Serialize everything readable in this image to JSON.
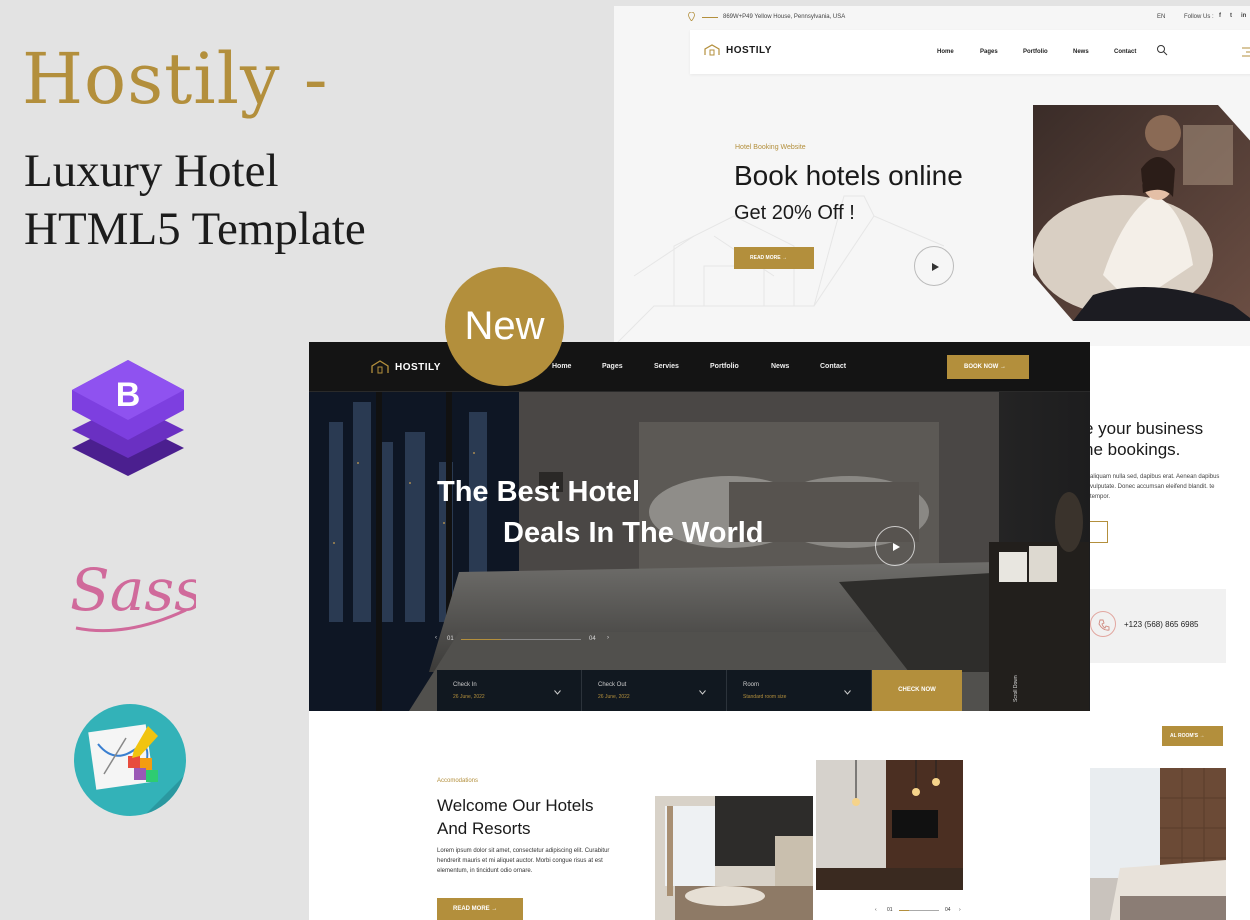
{
  "promo": {
    "title": "Hostily -",
    "subtitle_line1": "Luxury Hotel",
    "subtitle_line2": "HTML5 Template"
  },
  "badge": {
    "label": "New"
  },
  "colors": {
    "accent": "#b38f3c",
    "dark": "#141414",
    "light_bg": "#f6f6f6"
  },
  "icons": [
    "bootstrap-logo",
    "sass-logo",
    "design-palette-logo"
  ],
  "light_site": {
    "topbar": {
      "address": "869W+P49 Yellow House, Pennsylvania, USA",
      "language": "EN",
      "follow_label": "Follow Us :",
      "social": [
        "f",
        "t",
        "in"
      ]
    },
    "brand": "HOSTILY",
    "nav": [
      "Home",
      "Pages",
      "Portfolio",
      "News",
      "Contact"
    ],
    "hero": {
      "tag": "Hotel Booking Website",
      "heading": "Book hotels online",
      "subheading": "Get 20% Off !",
      "button": "READ MORE"
    },
    "about": {
      "heading_line1": "e your business",
      "heading_line2": "ne bookings.",
      "paragraph": "aliquam nulla sed, dapibus erat. Aenean dapibus vulputate. Donec accumsan eleifend blandit. te tempor."
    },
    "phone": "+123 (568) 865 6985",
    "rooms_button": "AL ROOM'S"
  },
  "dark_site": {
    "brand": "HOSTILY",
    "nav": [
      "Home",
      "Pages",
      "Servies",
      "Portfolio",
      "News",
      "Contact"
    ],
    "book_button": "BOOK NOW",
    "hero": {
      "title_line1": "The Best Hotel",
      "title_line2": "Deals In The World"
    },
    "slider": {
      "current": "01",
      "total": "04"
    },
    "booking": {
      "fields": [
        {
          "label": "Check In",
          "value": "26 June, 2022"
        },
        {
          "label": "Check Out",
          "value": "26 June, 2022"
        },
        {
          "label": "Room",
          "value": "Standard room size"
        }
      ],
      "button": "CHECK NOW"
    },
    "scroll_label": "Scroll Down",
    "accommodations": {
      "tag": "Accomodations",
      "heading_line1": "Welcome Our Hotels",
      "heading_line2": "And Resorts",
      "paragraph": "Lorem ipsum dolor sit amet, consectetur adipiscing elit. Curabitur hendrerit mauris et mi aliquet auctor. Morbi congue risus at est elementum, in tincidunt odio ornare.",
      "button": "READ MORE"
    },
    "mini_slider": {
      "current": "01",
      "total": "04"
    }
  }
}
